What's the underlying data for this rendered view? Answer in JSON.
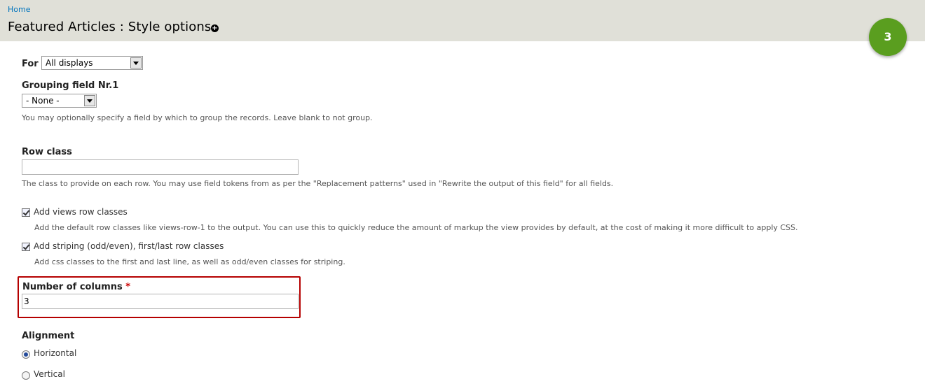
{
  "header": {
    "breadcrumb": "Home",
    "title": "Featured Articles : Style options",
    "shortcut_icon": "plus-circle-icon"
  },
  "step_badge": "3",
  "form": {
    "for_label": "For",
    "for_value": "All displays",
    "grouping_label": "Grouping field Nr.1",
    "grouping_value": "- None -",
    "grouping_desc": "You may optionally specify a field by which to group the records. Leave blank to not group.",
    "row_class_label": "Row class",
    "row_class_value": "",
    "row_class_desc": "The class to provide on each row. You may use field tokens from as per the \"Replacement patterns\" used in \"Rewrite the output of this field\" for all fields.",
    "views_row_label": "Add views row classes",
    "views_row_checked": true,
    "views_row_desc": "Add the default row classes like views-row-1 to the output. You can use this to quickly reduce the amount of markup the view provides by default, at the cost of making it more difficult to apply CSS.",
    "striping_label": "Add striping (odd/even), first/last row classes",
    "striping_checked": true,
    "striping_desc": "Add css classes to the first and last line, as well as odd/even classes for striping.",
    "columns_label": "Number of columns",
    "columns_required": "*",
    "columns_value": "3",
    "alignment_label": "Alignment",
    "alignment_options": [
      {
        "label": "Horizontal",
        "checked": true
      },
      {
        "label": "Vertical",
        "checked": false
      }
    ]
  },
  "colors": {
    "header_bg": "#e0e0d8",
    "badge": "#5a9e1f",
    "highlight": "#b50000",
    "link": "#0074bd"
  }
}
